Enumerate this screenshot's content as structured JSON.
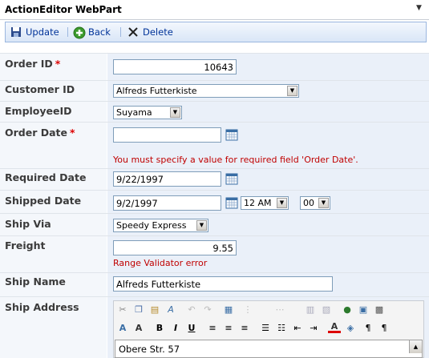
{
  "webpart": {
    "title": "ActionEditor WebPart"
  },
  "toolbar": {
    "update_label": "Update",
    "back_label": "Back",
    "delete_label": "Delete"
  },
  "form": {
    "order_id": {
      "label": "Order ID",
      "required_mark": "*",
      "value": "10643"
    },
    "customer_id": {
      "label": "Customer ID",
      "value": "Alfreds Futterkiste"
    },
    "employee_id": {
      "label": "EmployeeID",
      "value": "Suyama"
    },
    "order_date": {
      "label": "Order Date",
      "required_mark": "*",
      "value": "",
      "error": "You must specify a value for required field 'Order Date'."
    },
    "required_date": {
      "label": "Required Date",
      "value": "9/22/1997"
    },
    "shipped_date": {
      "label": "Shipped Date",
      "value": "9/2/1997",
      "hour": "12 AM",
      "minute": "00"
    },
    "ship_via": {
      "label": "Ship Via",
      "value": "Speedy Express"
    },
    "freight": {
      "label": "Freight",
      "value": "9.55",
      "error": "Range Validator error"
    },
    "ship_name": {
      "label": "Ship Name",
      "value": "Alfreds Futterkiste"
    },
    "ship_address": {
      "label": "Ship Address",
      "value": "Obere Str. 57"
    }
  },
  "colors": {
    "error": "#c00000",
    "required": "#dd0000",
    "link": "#003399",
    "toolbar_border": "#9cb7df"
  }
}
